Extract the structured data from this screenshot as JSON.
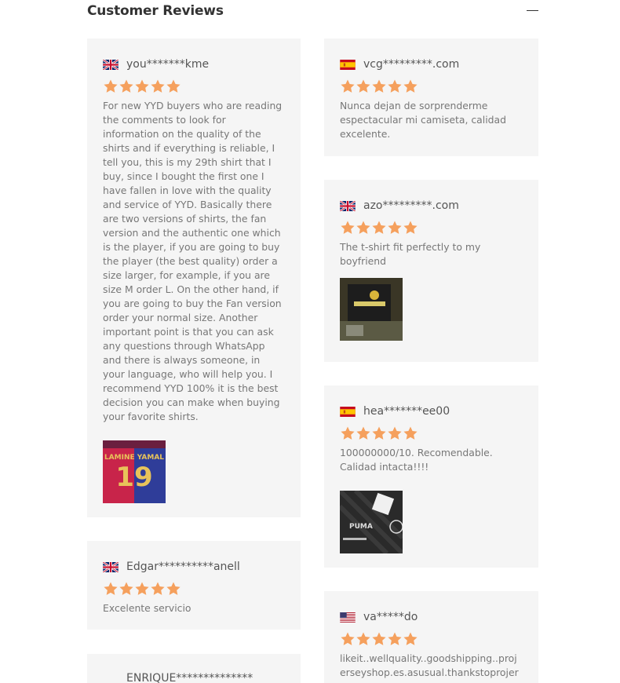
{
  "section": {
    "title": "Customer Reviews"
  },
  "colors": {
    "star": "#f5a05d",
    "card_bg": "#f5f5f5"
  },
  "reviews_left": [
    {
      "flag": "uk-flag-icon",
      "name": "you*******kme",
      "rating": 5,
      "text": "For new YYD buyers who are reading the comments to look for information on the quality of the shirts and if everything is reliable, I tell you, this is my 29th shirt that I buy, since I bought the first one I have fallen in love with the quality and service of YYD. Basically there are two versions of shirts, the fan version and the authentic one which is the player, if you are going to buy the player (the best quality) order a size larger, for example, if you are size M order L. On the other hand, if you are going to buy the Fan version order your normal size. Another important point is that you can ask any questions through WhatsApp and there is always someone, in your language, who will help you. I recommend YYD 100% it is the best decision you can make when buying your favorite shirts.",
      "photo": "jersey-photo-yamal-19"
    },
    {
      "flag": "uk-flag-icon",
      "name": "Edgar**********anell",
      "rating": 5,
      "text": "Excelente servicio"
    },
    {
      "name": "ENRIQUE**************"
    }
  ],
  "reviews_right": [
    {
      "flag": "spain-flag-icon",
      "name": "vcg*********.com",
      "rating": 5,
      "text": "Nunca dejan de sorprenderme espectacular mi camiseta, calidad excelente."
    },
    {
      "flag": "uk-flag-icon",
      "name": "azo*********.com",
      "rating": 5,
      "text": "The t-shirt fit perfectly to my boyfriend",
      "photo": "tshirt-photo"
    },
    {
      "flag": "spain-flag-icon",
      "name": "hea*******ee00",
      "rating": 5,
      "text": "100000000/10. Recomendable. Calidad intacta!!!!",
      "photo": "milan-jersey-photo"
    },
    {
      "flag": "usa-flag-icon",
      "name": "va*****do",
      "rating": 5,
      "text": "likeit..wellquality..goodshipping..projerseyshop.es.asusual.thankstoprojers"
    }
  ]
}
